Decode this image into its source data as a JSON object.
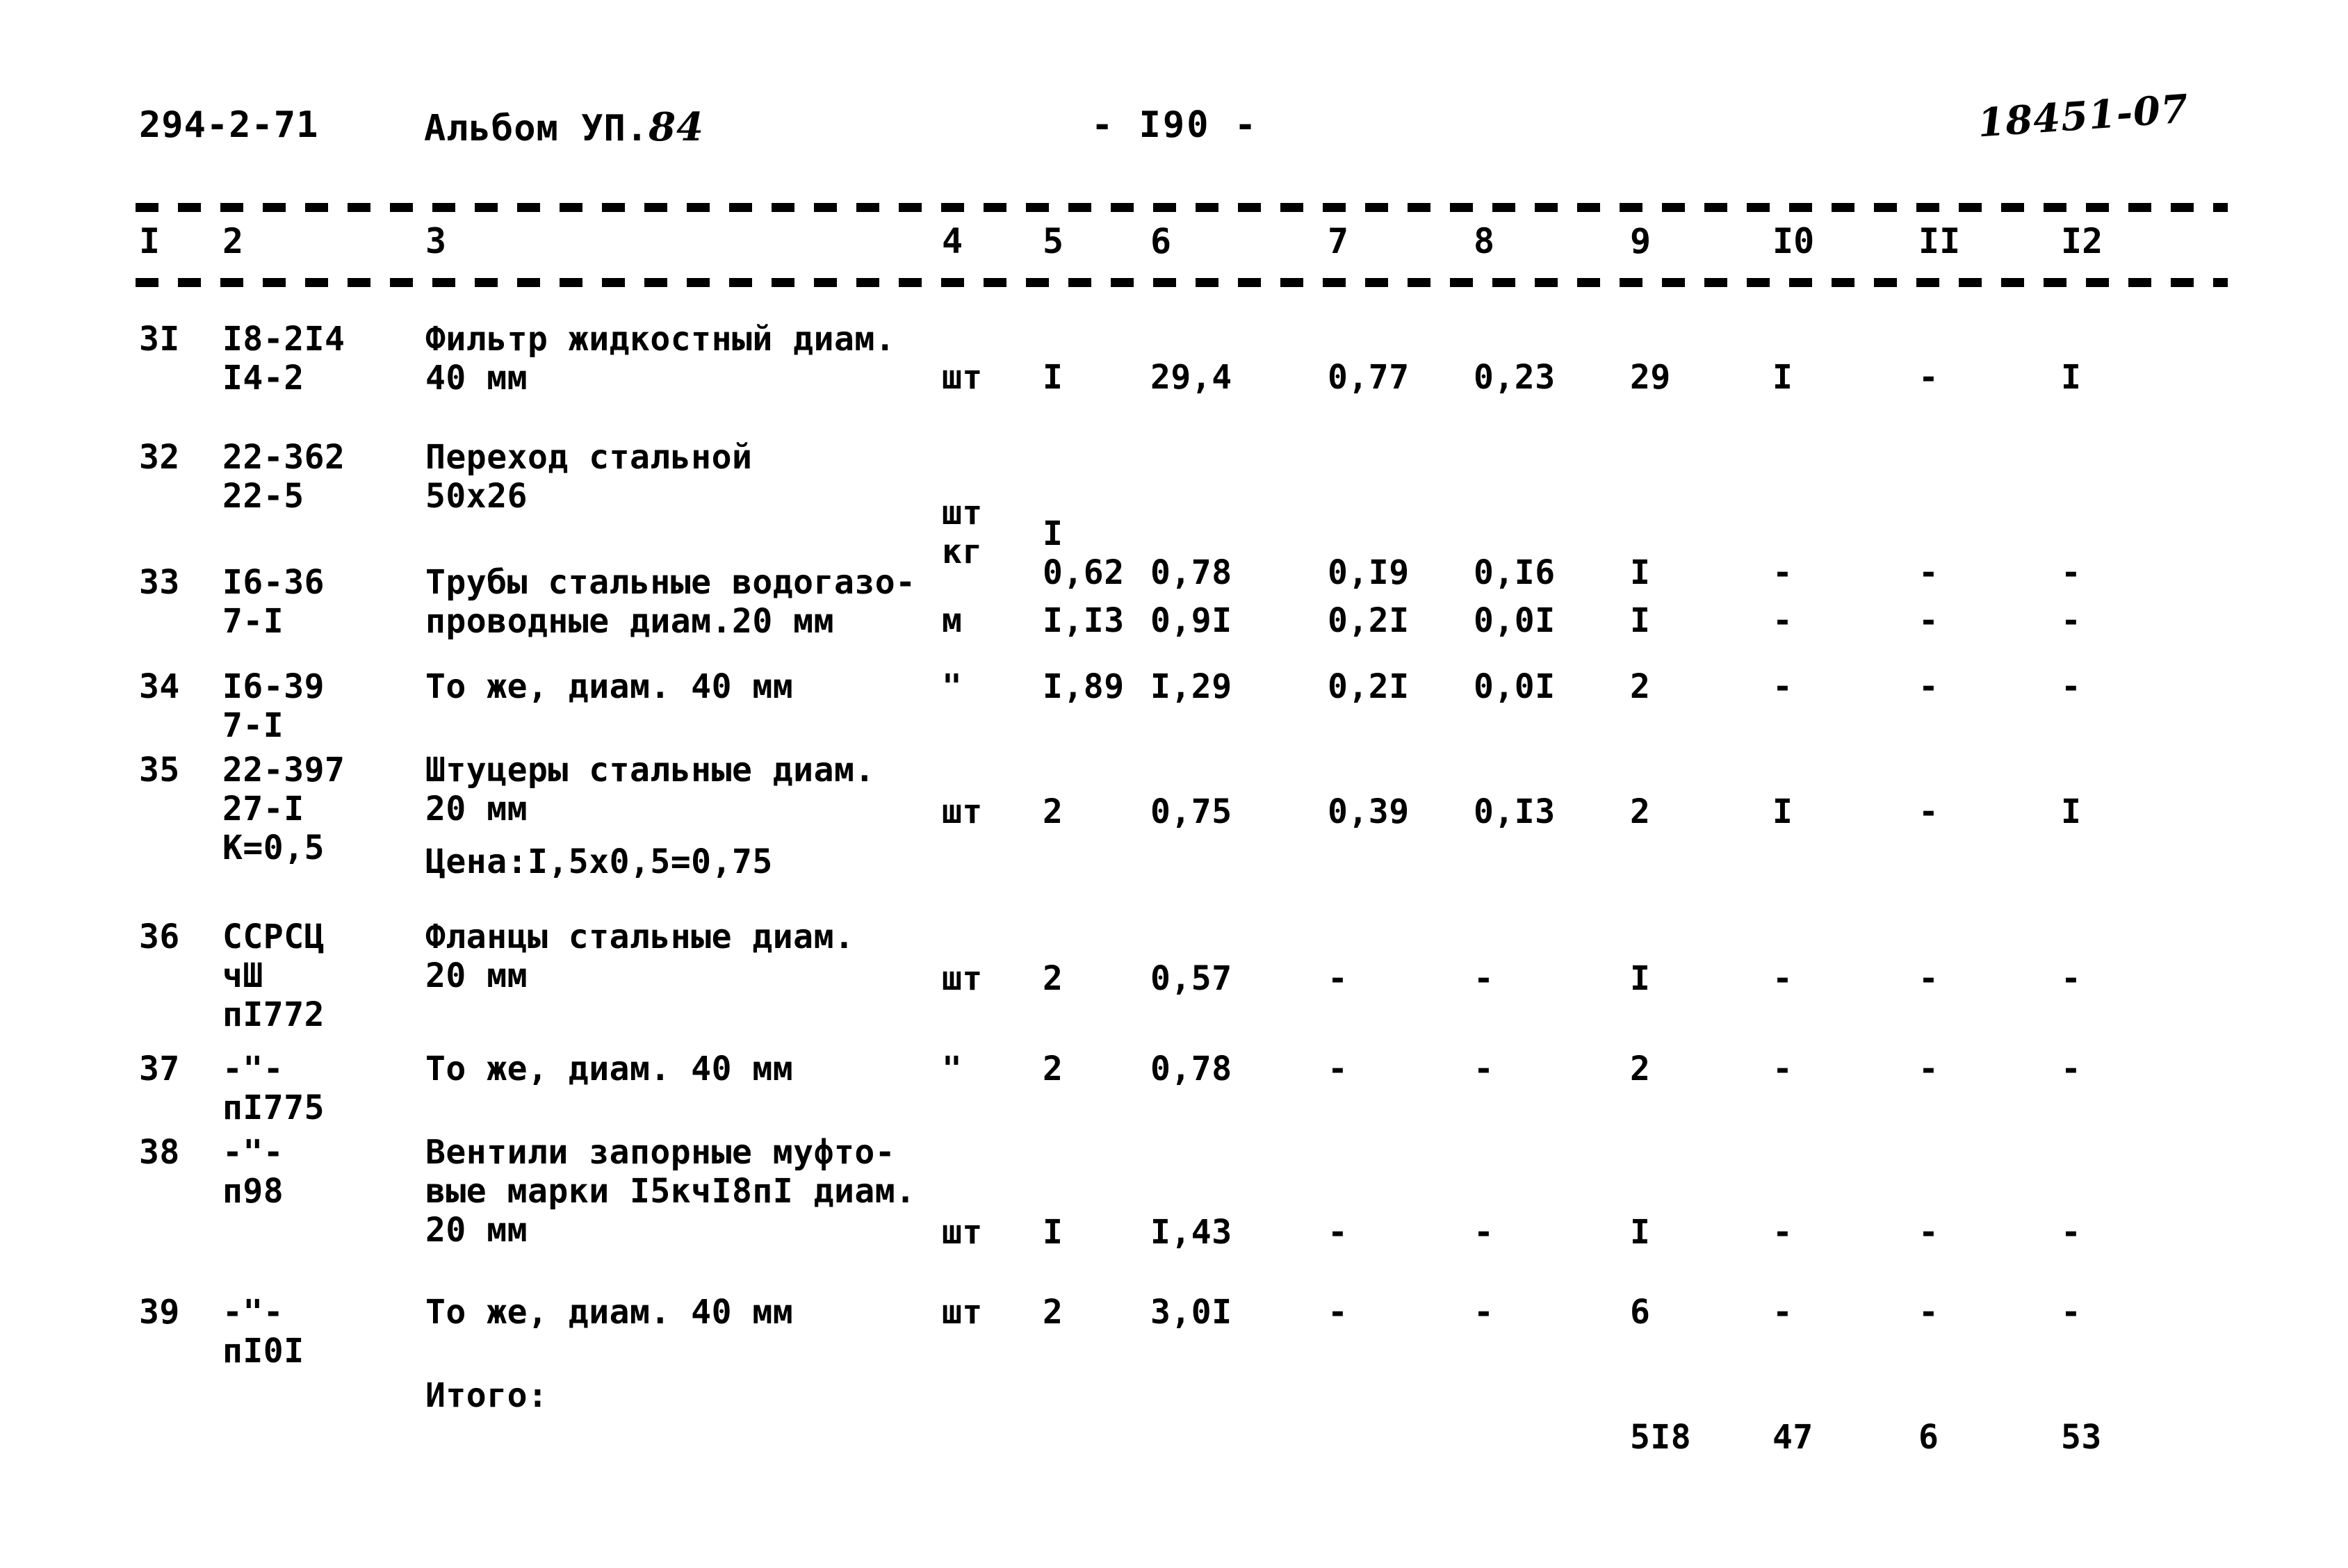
{
  "header": {
    "doc_code": "294-2-71",
    "album_label": "Альбом УП.",
    "album_number": "84",
    "page_marker": "- I90 -",
    "stamp": "18451-07"
  },
  "table": {
    "column_numbers": [
      "I",
      "2",
      "3",
      "4",
      "5",
      "6",
      "7",
      "8",
      "9",
      "I0",
      "II",
      "I2"
    ],
    "total_label": "Итого:",
    "totals": {
      "col9": "5I8",
      "col10": "47",
      "col11": "6",
      "col12": "53"
    },
    "rows": [
      {
        "no": "3I",
        "code": "I8-2I4\nI4-2",
        "desc": "Фильтр жидкостный диам.\n40 мм",
        "unit": "шт",
        "qty": "I",
        "v6": "29,4",
        "v7": "0,77",
        "v8": "0,23",
        "v9": "29",
        "v10": "I",
        "v11": "-",
        "v12": "I"
      },
      {
        "no": "32",
        "code": "22-362\n22-5",
        "desc": "Переход стальной\n50х26",
        "unit": "шт\nкг",
        "qty": "I\n0,62",
        "v6": "0,78",
        "v7": "0,I9",
        "v8": "0,I6",
        "v9": "I",
        "v10": "-",
        "v11": "-",
        "v12": "-"
      },
      {
        "no": "33",
        "code": "I6-36\n7-I",
        "desc": "Трубы стальные водогазо-\nпроводные диам.20 мм",
        "unit": "м",
        "qty": "I,I3",
        "v6": "0,9I",
        "v7": "0,2I",
        "v8": "0,0I",
        "v9": "I",
        "v10": "-",
        "v11": "-",
        "v12": "-"
      },
      {
        "no": "34",
        "code": "I6-39\n7-I",
        "desc": "То же, диам. 40 мм",
        "unit": "\"",
        "qty": "I,89",
        "v6": "I,29",
        "v7": "0,2I",
        "v8": "0,0I",
        "v9": "2",
        "v10": "-",
        "v11": "-",
        "v12": "-"
      },
      {
        "no": "35",
        "code": "22-397\n27-I\nК=0,5",
        "desc": "Штуцеры стальные диам.\n20 мм",
        "desc_note": "Цена:I,5х0,5=0,75",
        "unit": "шт",
        "qty": "2",
        "v6": "0,75",
        "v7": "0,39",
        "v8": "0,I3",
        "v9": "2",
        "v10": "I",
        "v11": "-",
        "v12": "I"
      },
      {
        "no": "36",
        "code": "ССРСЦ\nчШ\nпI772",
        "desc": "Фланцы стальные диам.\n20 мм",
        "unit": "шт",
        "qty": "2",
        "v6": "0,57",
        "v7": "-",
        "v8": "-",
        "v9": "I",
        "v10": "-",
        "v11": "-",
        "v12": "-"
      },
      {
        "no": "37",
        "code": "-\"-\nпI775",
        "desc": "То же, диам. 40 мм",
        "unit": "\"",
        "qty": "2",
        "v6": "0,78",
        "v7": "-",
        "v8": "-",
        "v9": "2",
        "v10": "-",
        "v11": "-",
        "v12": "-"
      },
      {
        "no": "38",
        "code": "-\"-\nп98",
        "desc": "Вентили запорные муфто-\nвые марки I5кчI8пI диам.\n20 мм",
        "unit": "шт",
        "qty": "I",
        "v6": "I,43",
        "v7": "-",
        "v8": "-",
        "v9": "I",
        "v10": "-",
        "v11": "-",
        "v12": "-"
      },
      {
        "no": "39",
        "code": "-\"-\nпI0I",
        "desc": "То же, диам. 40 мм",
        "unit": "шт",
        "qty": "2",
        "v6": "3,0I",
        "v7": "-",
        "v8": "-",
        "v9": "6",
        "v10": "-",
        "v11": "-",
        "v12": "-"
      }
    ]
  }
}
